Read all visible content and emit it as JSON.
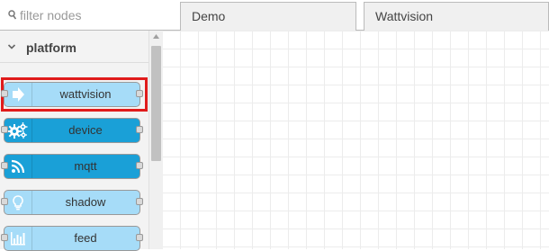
{
  "filter": {
    "placeholder": "filter nodes"
  },
  "tabs": [
    {
      "label": "Demo"
    },
    {
      "label": "Wattvision"
    }
  ],
  "palette": {
    "category": "platform",
    "nodes": [
      {
        "label": "wattvision",
        "color": "#a6dcf8",
        "icon": "arrow-in-icon",
        "selected": true
      },
      {
        "label": "device",
        "color": "#1aa0d7",
        "icon": "gears-icon",
        "selected": false
      },
      {
        "label": "mqtt",
        "color": "#1aa0d7",
        "icon": "feed-signal-icon",
        "selected": false
      },
      {
        "label": "shadow",
        "color": "#a6dcf8",
        "icon": "lightbulb-icon",
        "selected": false
      },
      {
        "label": "feed",
        "color": "#a6dcf8",
        "icon": "bar-chart-icon",
        "selected": false
      }
    ]
  },
  "colors": {
    "selection": "#e01b1b",
    "accent": "#1aa0d7"
  }
}
